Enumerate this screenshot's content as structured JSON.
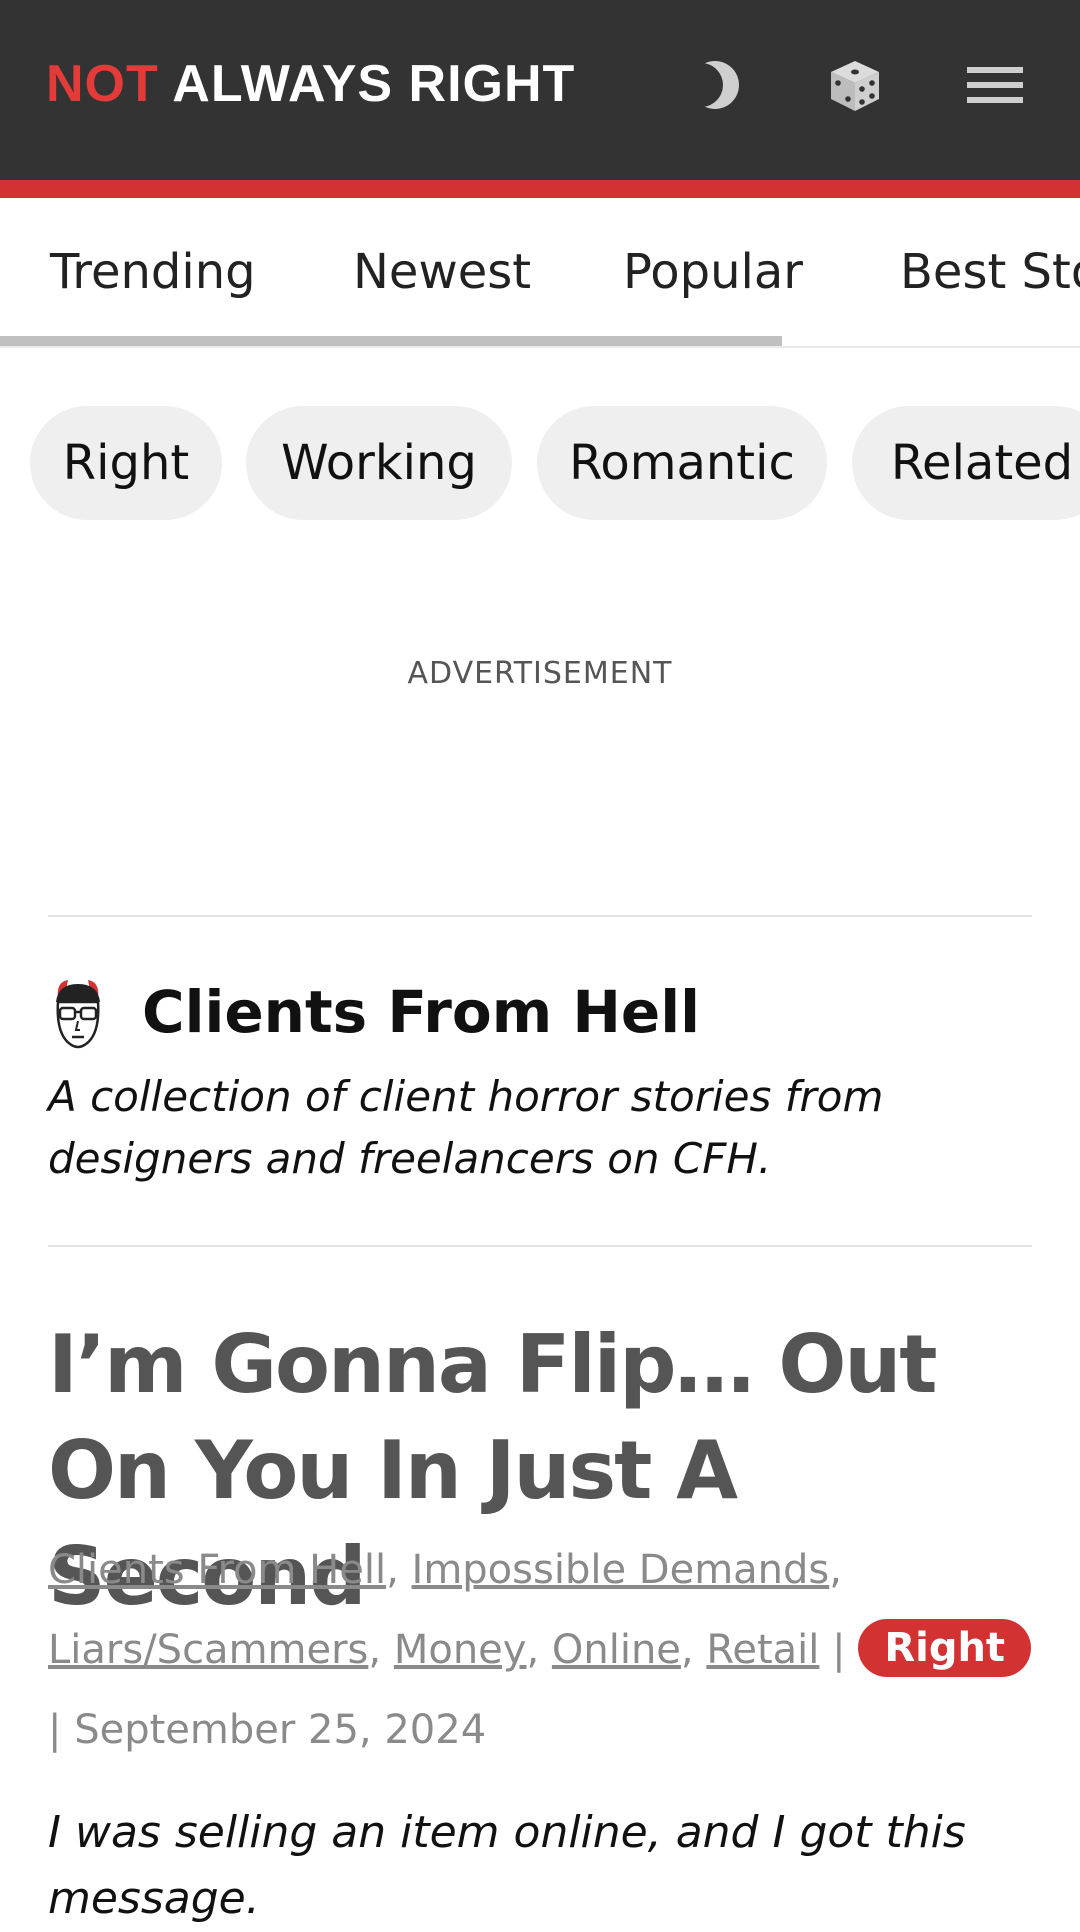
{
  "header": {
    "logo_part1": "NOT",
    "logo_part2": "ALWAYS RIGHT",
    "icons": [
      "moon-icon",
      "dice-icon",
      "menu-icon"
    ],
    "colors": {
      "bar": "#333333",
      "accent": "#d33232"
    }
  },
  "tabs": [
    {
      "label": "Trending"
    },
    {
      "label": "Newest"
    },
    {
      "label": "Popular"
    },
    {
      "label": "Best Sto"
    }
  ],
  "chips": [
    {
      "label": "Right"
    },
    {
      "label": "Working"
    },
    {
      "label": "Romantic"
    },
    {
      "label": "Related"
    }
  ],
  "ad": {
    "label": "ADVERTISEMENT"
  },
  "category": {
    "title": "Clients From Hell",
    "description": "A collection of client horror stories from designers and freelancers on CFH."
  },
  "story": {
    "title": "I’m Gonna Flip… Out On You In Just A Second",
    "tags": [
      "Clients From Hell",
      "Impossible Demands",
      "Liars/Scammers",
      "Money",
      "Online",
      "Retail"
    ],
    "badge": "Right",
    "separator": "|",
    "date": "September 25, 2024",
    "body": "I was selling an item online, and I got this message."
  }
}
